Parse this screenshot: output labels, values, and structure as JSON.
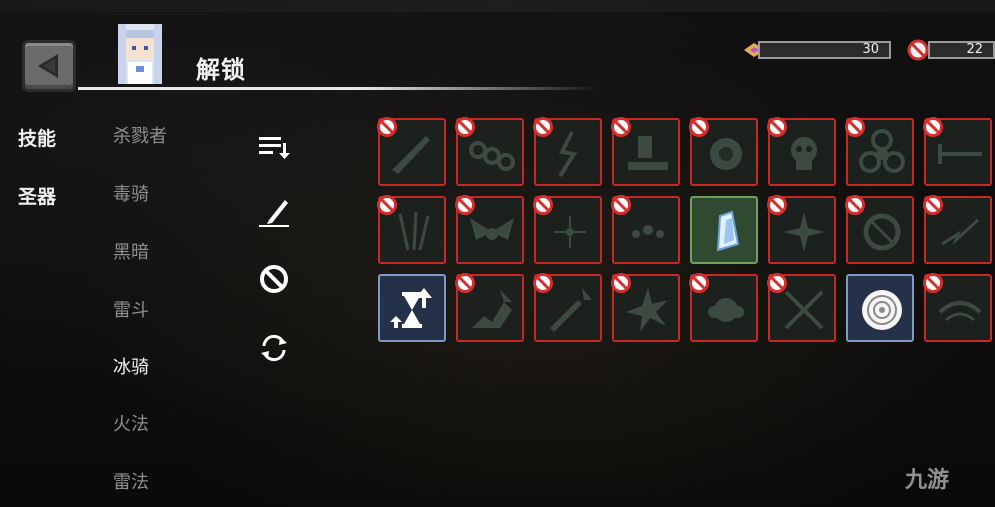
{
  "header": {
    "title": "解锁"
  },
  "resources": [
    {
      "icon": "gem-icon",
      "value": "30"
    },
    {
      "icon": "ban-icon",
      "value": "22"
    }
  ],
  "categories": [
    "技能",
    "圣器"
  ],
  "classes": [
    {
      "label": "杀戮者",
      "active": false
    },
    {
      "label": "毒骑",
      "active": false
    },
    {
      "label": "黑暗",
      "active": false
    },
    {
      "label": "雷斗",
      "active": false
    },
    {
      "label": "冰骑",
      "active": true
    },
    {
      "label": "火法",
      "active": false
    },
    {
      "label": "雷法",
      "active": false
    }
  ],
  "tools": [
    "sort-icon",
    "pen-icon",
    "ban-filter-icon",
    "refresh-icon"
  ],
  "skills": [
    [
      {
        "state": "locked",
        "icon": "slash-icon"
      },
      {
        "state": "locked",
        "icon": "chain-icon"
      },
      {
        "state": "locked",
        "icon": "lightning-icon"
      },
      {
        "state": "locked",
        "icon": "ground-pound-icon"
      },
      {
        "state": "locked",
        "icon": "fireball-icon"
      },
      {
        "state": "locked",
        "icon": "skull-icon"
      },
      {
        "state": "locked",
        "icon": "biohazard-icon"
      },
      {
        "state": "locked",
        "icon": "sword-icon"
      }
    ],
    [
      {
        "state": "locked",
        "icon": "blades-icon"
      },
      {
        "state": "locked",
        "icon": "wings-icon"
      },
      {
        "state": "locked",
        "icon": "sparkle-icon"
      },
      {
        "state": "locked",
        "icon": "dust-icon"
      },
      {
        "state": "unlocked-green",
        "icon": "ice-shard-icon"
      },
      {
        "state": "locked",
        "icon": "shuriken-icon"
      },
      {
        "state": "locked",
        "icon": "ring-icon"
      },
      {
        "state": "locked",
        "icon": "thunder-bolt-icon"
      }
    ],
    [
      {
        "state": "unlocked-blue",
        "icon": "hourglass-up-icon"
      },
      {
        "state": "locked",
        "icon": "stairs-up-icon"
      },
      {
        "state": "locked",
        "icon": "sword-up-icon"
      },
      {
        "state": "locked",
        "icon": "burst-icon"
      },
      {
        "state": "locked",
        "icon": "fog-icon"
      },
      {
        "state": "locked",
        "icon": "crossed-swords-icon"
      },
      {
        "state": "unlocked-blue",
        "icon": "vortex-icon"
      },
      {
        "state": "locked",
        "icon": "wind-icon"
      }
    ]
  ],
  "watermark": "九游",
  "colors": {
    "locked_border": "#c62828",
    "green_border": "#6fa060",
    "blue_border": "#7f9bc4"
  }
}
